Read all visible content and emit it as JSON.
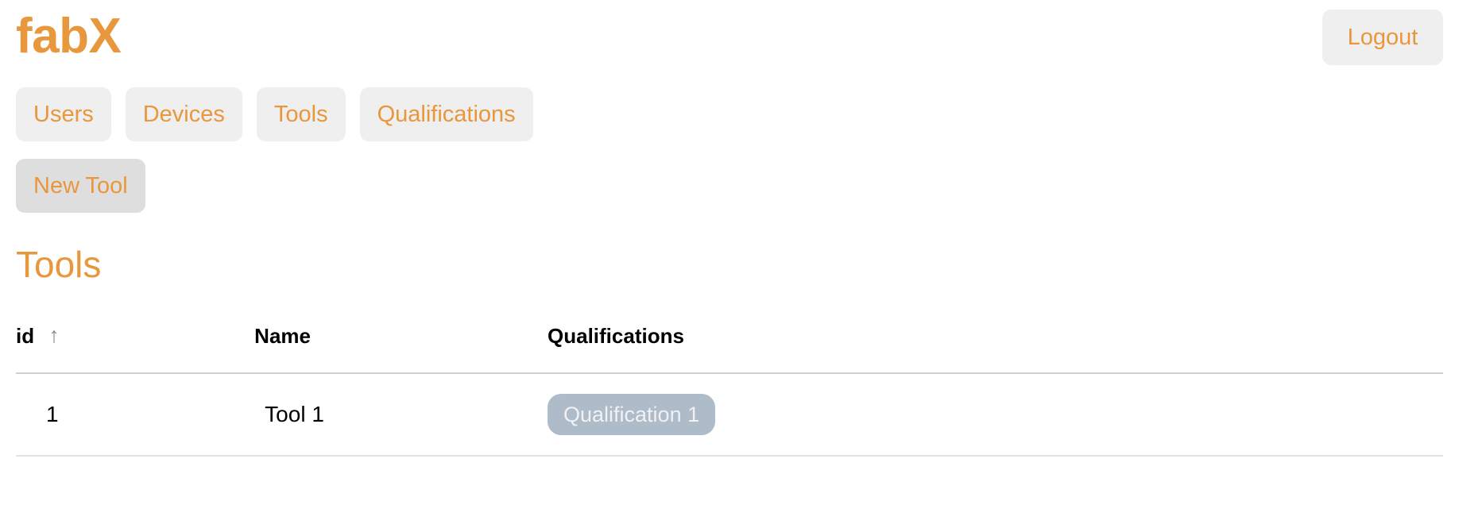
{
  "app": {
    "brand": "fabX",
    "brand_color": "#e8973c"
  },
  "header": {
    "logout_label": "Logout"
  },
  "nav": {
    "items": [
      {
        "label": "Users"
      },
      {
        "label": "Devices"
      },
      {
        "label": "Tools"
      },
      {
        "label": "Qualifications"
      }
    ]
  },
  "actions": {
    "items": [
      {
        "label": "New Tool"
      }
    ]
  },
  "main": {
    "title": "Tools",
    "table": {
      "columns": [
        {
          "key": "id",
          "label": "id",
          "sort": "asc",
          "sort_icon": "arrow-up-icon"
        },
        {
          "key": "name",
          "label": "Name",
          "sort": "none"
        },
        {
          "key": "qualifications",
          "label": "Qualifications",
          "sort": "none"
        }
      ],
      "rows": [
        {
          "id": "1",
          "name": "Tool 1",
          "qualifications": [
            "Qualification 1"
          ]
        }
      ]
    }
  },
  "colors": {
    "accent": "#e8973c",
    "button_bg": "#efefef",
    "action_button_bg": "#dedede",
    "chip_bg": "#aebbc9",
    "chip_text": "#f0f1f3",
    "header_rule": "#cfcfcf",
    "row_rule": "#e3e3e3"
  },
  "icons": {
    "sort_ascending": "↑"
  }
}
